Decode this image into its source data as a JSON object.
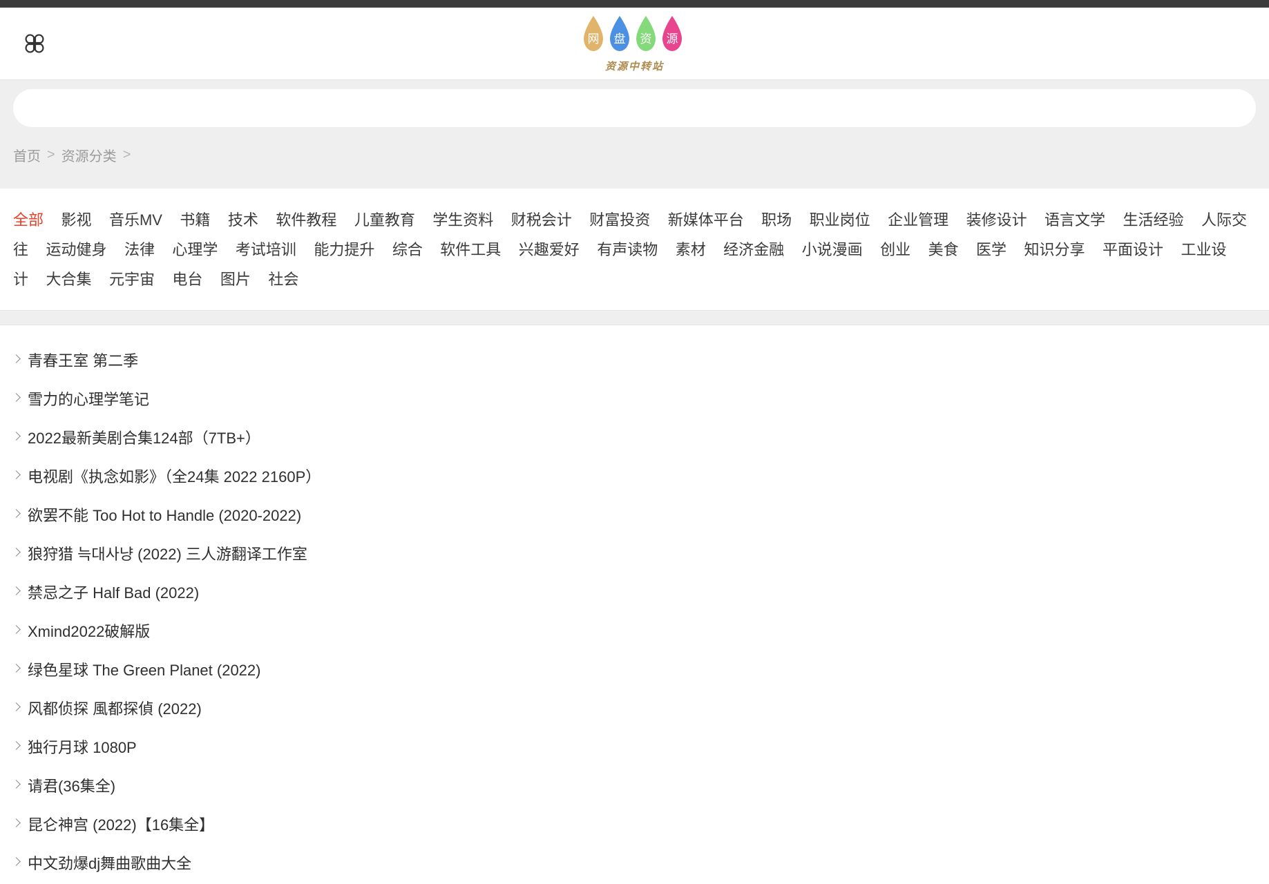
{
  "header": {
    "menu_icon": "clover-menu-icon",
    "logo": {
      "drops": [
        {
          "char": "网",
          "color": "#e3b濃"
        },
        {
          "char": "盘",
          "color": "#4b90e2"
        },
        {
          "char": "资",
          "color": "#84da7a"
        },
        {
          "char": "源",
          "color": "#e8458f"
        }
      ],
      "subtitle": "资源中转站"
    }
  },
  "search": {
    "value": "",
    "placeholder": ""
  },
  "breadcrumb": {
    "items": [
      "首页",
      "资源分类"
    ],
    "separator": ">"
  },
  "categories": {
    "active": "全部",
    "items": [
      "全部",
      "影视",
      "音乐MV",
      "书籍",
      "技术",
      "软件教程",
      "儿童教育",
      "学生资料",
      "财税会计",
      "财富投资",
      "新媒体平台",
      "职场",
      "职业岗位",
      "企业管理",
      "装修设计",
      "语言文学",
      "生活经验",
      "人际交往",
      "运动健身",
      "法律",
      "心理学",
      "考试培训",
      "能力提升",
      "综合",
      "软件工具",
      "兴趣爱好",
      "有声读物",
      "素材",
      "经济金融",
      "小说漫画",
      "创业",
      "美食",
      "医学",
      "知识分享",
      "平面设计",
      "工业设计",
      "大合集",
      "元宇宙",
      "电台",
      "图片",
      "社会"
    ]
  },
  "list": {
    "items": [
      "青春王室 第二季",
      "雪力的心理学笔记",
      "2022最新美剧合集124部（7TB+）",
      "电视剧《执念如影》（全24集 2022 2160P）",
      "欲罢不能 Too Hot to Handle (2020-2022)",
      "狼狩猎 늑대사냥 (2022) 三人游翻译工作室",
      "禁忌之子 Half Bad (2022)",
      "Xmind2022破解版",
      "绿色星球 The Green Planet (2022)",
      "风都侦探 風都探偵 (2022)",
      "独行月球 1080P",
      "请君(36集全)",
      "昆仑神宫 (2022)【16集全】",
      "中文劲爆dj舞曲歌曲大全"
    ]
  },
  "colors": {
    "topbar": "#3b3b3b",
    "band": "#efefef",
    "accent": "#e8402a",
    "text": "#2f2f2f",
    "muted": "#9b9b9b"
  }
}
